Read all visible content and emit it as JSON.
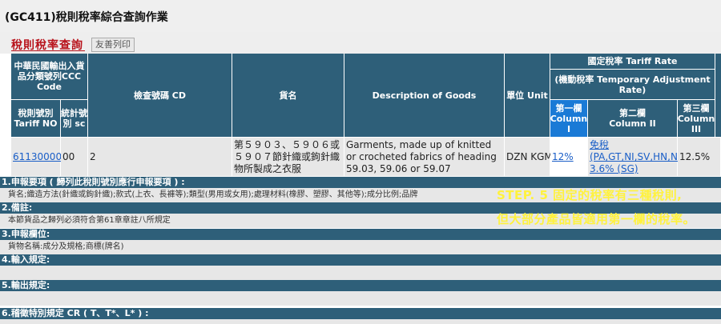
{
  "page_title": "(GC411)稅則稅率綜合查詢作業",
  "section_title": "稅則稅率查詢",
  "print_button": "友善列印",
  "headers": {
    "ccc_group": "中華民國輸出入貨品分類號列CCC Code",
    "tariff_no": "稅則號別 Tariff NO",
    "stat_no": "統計號別 sc",
    "cd": "檢查號碼 CD",
    "goods_name": "貨名",
    "description": "Description of Goods",
    "unit": "單位 Unit",
    "tariff_rate": "國定稅率 Tariff Rate",
    "temp_rate": "(機動稅率 Temporary Adjustment Rate)",
    "col1_a": "第一欄",
    "col1_b": "Column",
    "col1_c": "I",
    "col2_a": "第二欄",
    "col2_b": "Column II",
    "col3_a": "第三欄",
    "col3_b": "Column",
    "col3_c": "III"
  },
  "row": {
    "tariff_no": "61130000",
    "stat_no": "00",
    "cd": "2",
    "goods_name": "第５９０３、５９０６或５９０７節針織或鉤針織物所製成之衣服",
    "description": "Garments, made up of knitted or crocheted fabrics of heading 59.03, 59.06 or 59.07",
    "unit": "DZN KGM",
    "col1": "12%",
    "col2_line1": "免稅",
    "col2_line2": "(PA,GT,NI,SV,HN,NZ)",
    "col2_line3": "3.6% (SG)",
    "col3": "12.5%"
  },
  "sections": [
    {
      "title": "1.申報要項 ( 歸列此稅則號別應行申報要項 ) :",
      "body": "貨名;織造方法(針織或鉤針織);款式(上衣、長褲等);類型(男用或女用);處理材料(橡膠、塑膠、其他等);成分比例;品牌"
    },
    {
      "title": "2.備註:",
      "body": "本節貨品之歸列必須符合第61章章註八所規定"
    },
    {
      "title": "3.申報欄位:",
      "body": "貨物名稱:成分及規格;商標(牌名)"
    },
    {
      "title": "4.輸入規定:",
      "body": ""
    },
    {
      "title": "5.輸出規定:",
      "body": ""
    },
    {
      "title": "6.稽徵特別規定 CR ( T、T*、L* ) :",
      "body": ""
    }
  ],
  "callout": {
    "line1": "STEP. 5  固定的稅率有三種稅則,",
    "line2": "但大部分產品皆適用第一欄的稅率。",
    "color": "#fff23d"
  },
  "colors": {
    "header_bg": "#2e5f79",
    "active_header_bg": "#1a7ad6",
    "title_red": "#b8121b",
    "row_bg": "#e7e7e7"
  }
}
